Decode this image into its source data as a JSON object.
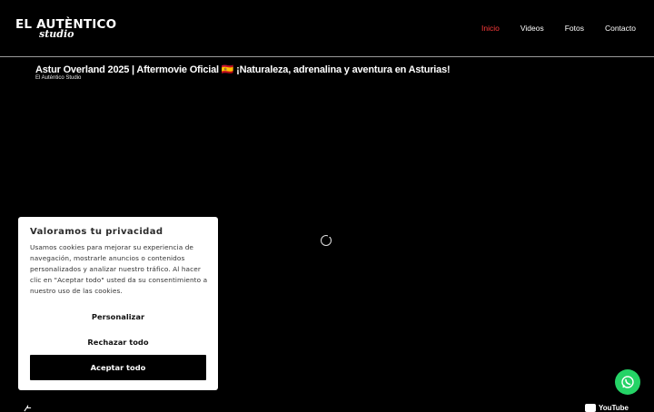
{
  "header": {
    "logo_main": "EL AUTÈNTICO",
    "logo_sub": "studio",
    "nav": [
      "Inicio",
      "Videos",
      "Fotos",
      "Contacto"
    ]
  },
  "video": {
    "title": "Astur Overland 2025 | Aftermovie Oficial 🇪🇸 ¡Naturaleza, adrenalina y aventura en Asturias!",
    "channel": "El Auténtico Studio",
    "provider": "YouTube"
  },
  "cookie": {
    "title": "Valoramos tu privacidad",
    "text": "Usamos cookies para mejorar su experiencia de navegación, mostrarle anuncios o contenidos personalizados y analizar nuestro tráfico. Al hacer clic en \"Aceptar todo\" usted da su consentimiento a nuestro uso de las cookies.",
    "customize_label": "Personalizar",
    "reject_label": "Rechazar todo",
    "accept_label": "Aceptar todo"
  },
  "colors": {
    "nav_active": "#ff3b3b",
    "whatsapp": "#25d366"
  }
}
